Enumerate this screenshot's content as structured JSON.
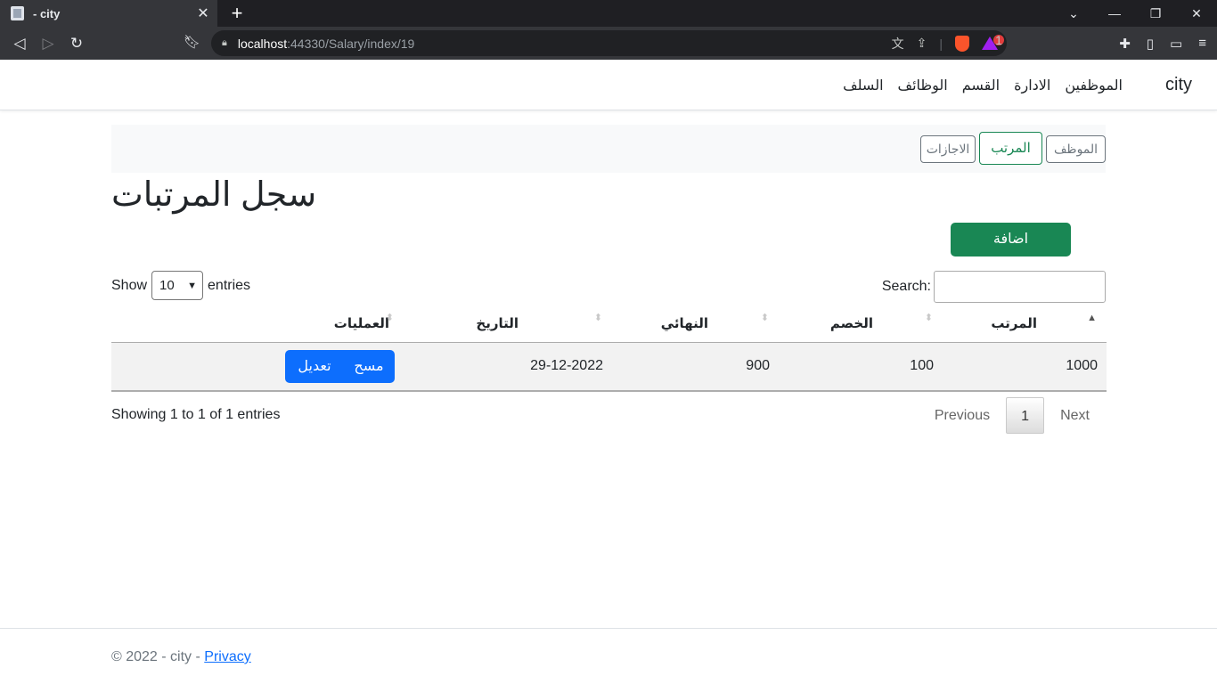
{
  "browser": {
    "tab_title": "- city",
    "url_host": "localhost",
    "url_rest": ":44330/Salary/index/19",
    "badge_count": "1"
  },
  "navbar": {
    "brand": "city",
    "links": [
      "الموظفين",
      "الادارة",
      "القسم",
      "الوظائف",
      "السلف"
    ]
  },
  "subnav": {
    "employee": "الموظف",
    "salary": "المرتب",
    "vacations": "الاجازات"
  },
  "page": {
    "title": "سجل المرتبات",
    "add_label": "اضافة"
  },
  "datatable": {
    "show_label": "Show",
    "entries_label": "entries",
    "page_length": "10",
    "search_label": "Search:",
    "columns": [
      "المرتب",
      "الخصم",
      "النهائي",
      "التاريخ",
      "العمليات"
    ],
    "rows": [
      {
        "salary": "1000",
        "discount": "100",
        "net": "900",
        "date": "29-12-2022",
        "delete": "مسح",
        "edit": "تعديل"
      }
    ],
    "info": "Showing 1 to 1 of 1 entries",
    "previous": "Previous",
    "current_page": "1",
    "next": "Next"
  },
  "footer": {
    "copyright": "© 2022 - city - ",
    "privacy": "Privacy"
  }
}
